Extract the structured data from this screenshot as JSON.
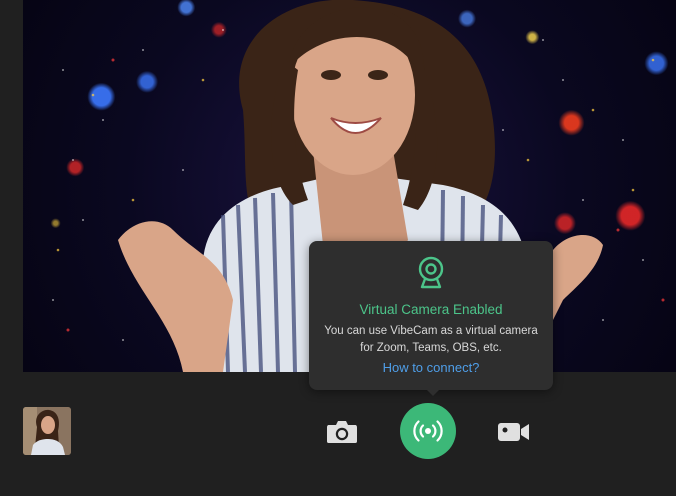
{
  "popup": {
    "title": "Virtual Camera Enabled",
    "desc_line1": "You can use VibeCam as a virtual camera",
    "desc_line2": "for Zoom, Teams, OBS, etc.",
    "link": "How to connect?"
  },
  "toolbar": {
    "photo_icon": "camera-icon",
    "virtual_camera_icon": "broadcast-icon",
    "record_icon": "video-camera-icon"
  },
  "colors": {
    "accent": "#3cb878",
    "title": "#4cc58a",
    "link": "#4f9ee8",
    "popup_bg": "#2e2e2e",
    "app_bg": "#202020"
  }
}
